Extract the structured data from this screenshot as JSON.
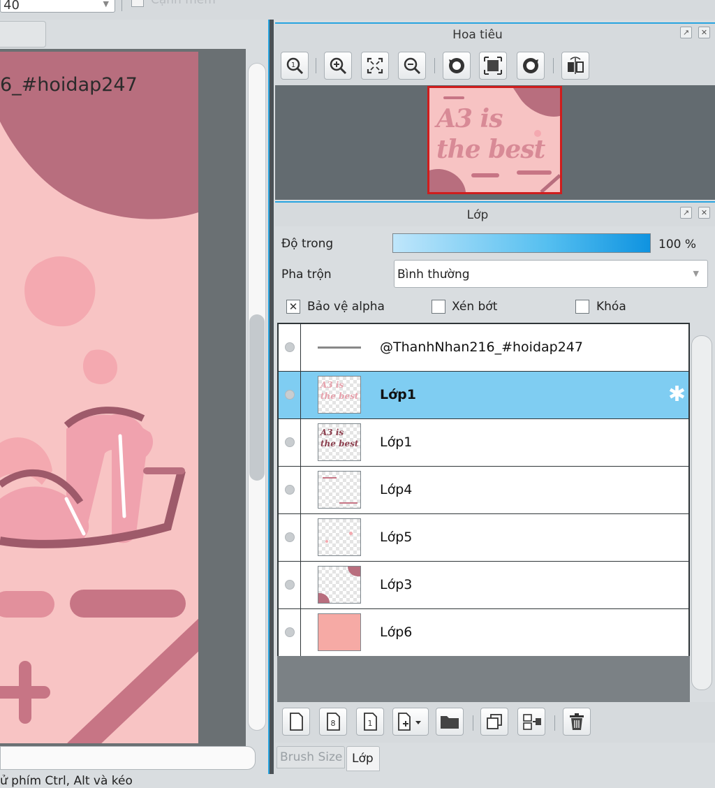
{
  "top_toolbar": {
    "brush_size_value": "40",
    "antialias_label": "Cạnh mềm"
  },
  "canvas": {
    "watermark_text": "6_#hoidap247"
  },
  "status_bar": {
    "hint_text": "ử phím Ctrl, Alt và kéo"
  },
  "navigator": {
    "title": "Hoa tiêu",
    "thumbnail_text": [
      "A3 is",
      "the best"
    ],
    "toolbar_icons": [
      "zoom-actual-icon",
      "zoom-in-icon",
      "fit-window-icon",
      "zoom-out-icon",
      "rotate-left-icon",
      "reset-view-icon",
      "rotate-right-icon",
      "flip-horizontal-icon"
    ]
  },
  "layer_panel": {
    "title": "Lớp",
    "opacity_label": "Độ trong",
    "opacity_value": "100 %",
    "opacity_fraction": 1.0,
    "blend_label": "Pha trộn",
    "blend_value": "Bình thường",
    "protect_alpha_label": "Bảo vệ alpha",
    "protect_alpha_checked": true,
    "clipping_label": "Xén bớt",
    "clipping_checked": false,
    "lock_label": "Khóa",
    "lock_checked": false,
    "layers": [
      {
        "name": "@ThanhNhan216_#hoidap247",
        "selected": false
      },
      {
        "name": "Lớp1",
        "selected": true
      },
      {
        "name": "Lớp1",
        "selected": false
      },
      {
        "name": "Lớp4",
        "selected": false
      },
      {
        "name": "Lớp5",
        "selected": false
      },
      {
        "name": "Lớp3",
        "selected": false
      },
      {
        "name": "Lớp6",
        "selected": false
      }
    ],
    "thumb_labels": [
      "A3 is",
      "the best"
    ],
    "toolbar_icons": [
      "new-layer-icon",
      "new-8bit-layer-icon",
      "new-1bit-layer-icon",
      "add-layer-menu-icon",
      "new-folder-icon",
      "duplicate-layer-icon",
      "merge-down-icon",
      "delete-layer-icon"
    ]
  },
  "bottom_tabs": {
    "brush_size": "Brush Size",
    "layer": "Lớp"
  },
  "colors": {
    "accent_blue": "#28a4e0",
    "selected_row": "#7fcdf2",
    "canvas_pink": "#f8c4c4",
    "canvas_rose": "#b86e7e",
    "nav_frame_red": "#cf1d1d"
  }
}
